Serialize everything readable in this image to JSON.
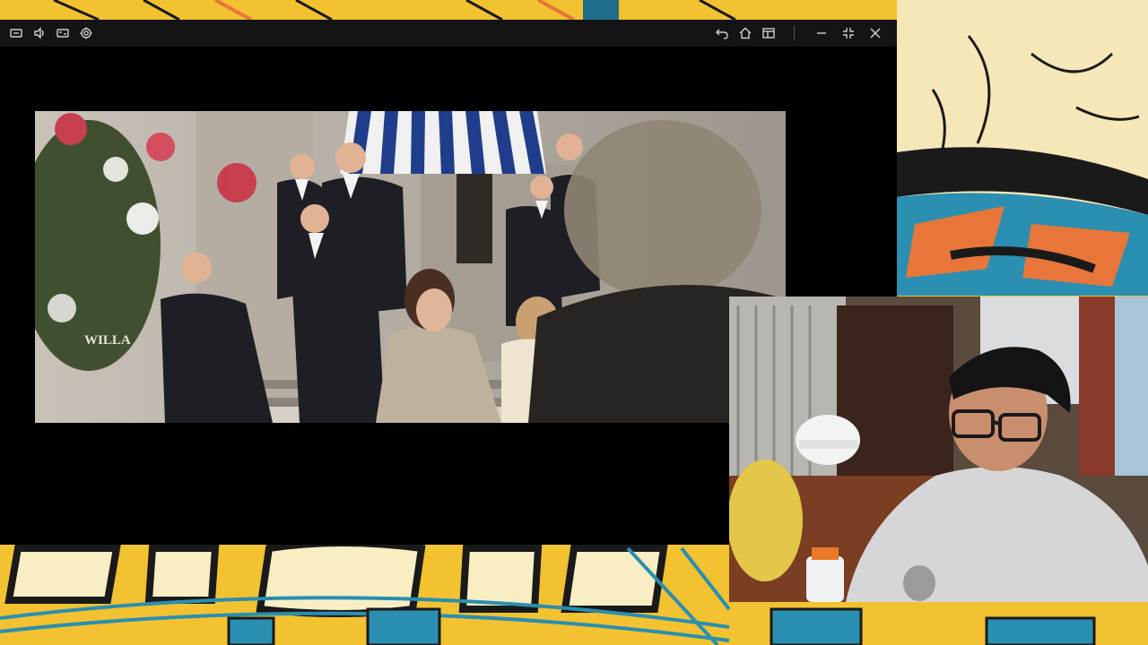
{
  "player": {
    "toolbar_left": [
      {
        "name": "display-mode-icon"
      },
      {
        "name": "volume-icon"
      },
      {
        "name": "caption-icon"
      },
      {
        "name": "settings-icon"
      }
    ],
    "toolbar_right": [
      {
        "name": "undo-icon"
      },
      {
        "name": "home-icon"
      },
      {
        "name": "layout-icon"
      }
    ],
    "window_controls": [
      {
        "name": "minimize-icon"
      },
      {
        "name": "restore-icon"
      },
      {
        "name": "close-icon"
      }
    ]
  },
  "video": {
    "sign_text": "WILLA"
  },
  "colors": {
    "backdrop_yellow": "#f2c230",
    "player_bg": "#000000",
    "titlebar_bg": "#141414"
  }
}
